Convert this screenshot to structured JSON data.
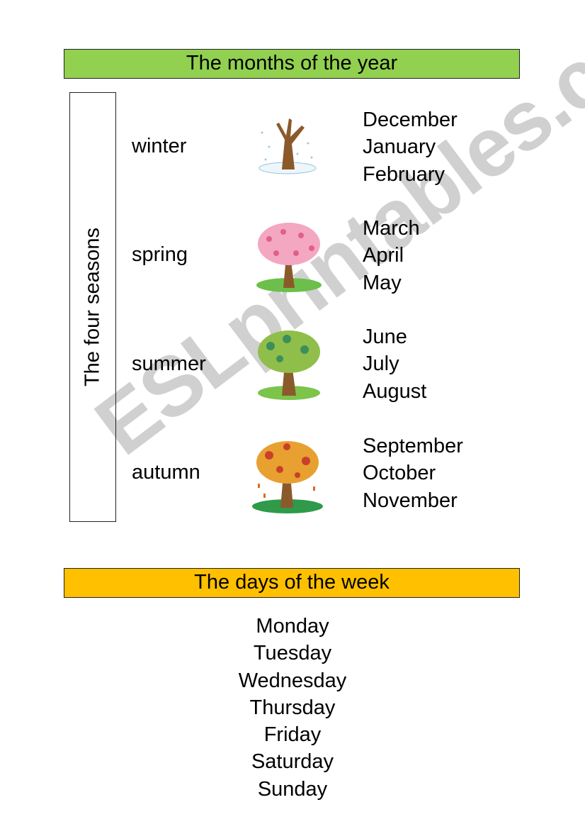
{
  "months_section": {
    "title": "The months of the year",
    "side_label": "The four seasons",
    "seasons": [
      {
        "name": "winter",
        "tree_icon": "winter-tree-icon",
        "months": [
          "December",
          "January",
          "February"
        ]
      },
      {
        "name": "spring",
        "tree_icon": "spring-tree-icon",
        "months": [
          "March",
          "April",
          "May"
        ]
      },
      {
        "name": "summer",
        "tree_icon": "summer-tree-icon",
        "months": [
          "June",
          "July",
          "August"
        ]
      },
      {
        "name": "autumn",
        "tree_icon": "autumn-tree-icon",
        "months": [
          "September",
          "October",
          "November"
        ]
      }
    ]
  },
  "days_section": {
    "title": "The days of the week",
    "days": [
      "Monday",
      "Tuesday",
      "Wednesday",
      "Thursday",
      "Friday",
      "Saturday",
      "Sunday"
    ]
  },
  "watermark": "ESLprintables.com",
  "colors": {
    "months_banner": "#92d050",
    "days_banner": "#ffc000"
  }
}
